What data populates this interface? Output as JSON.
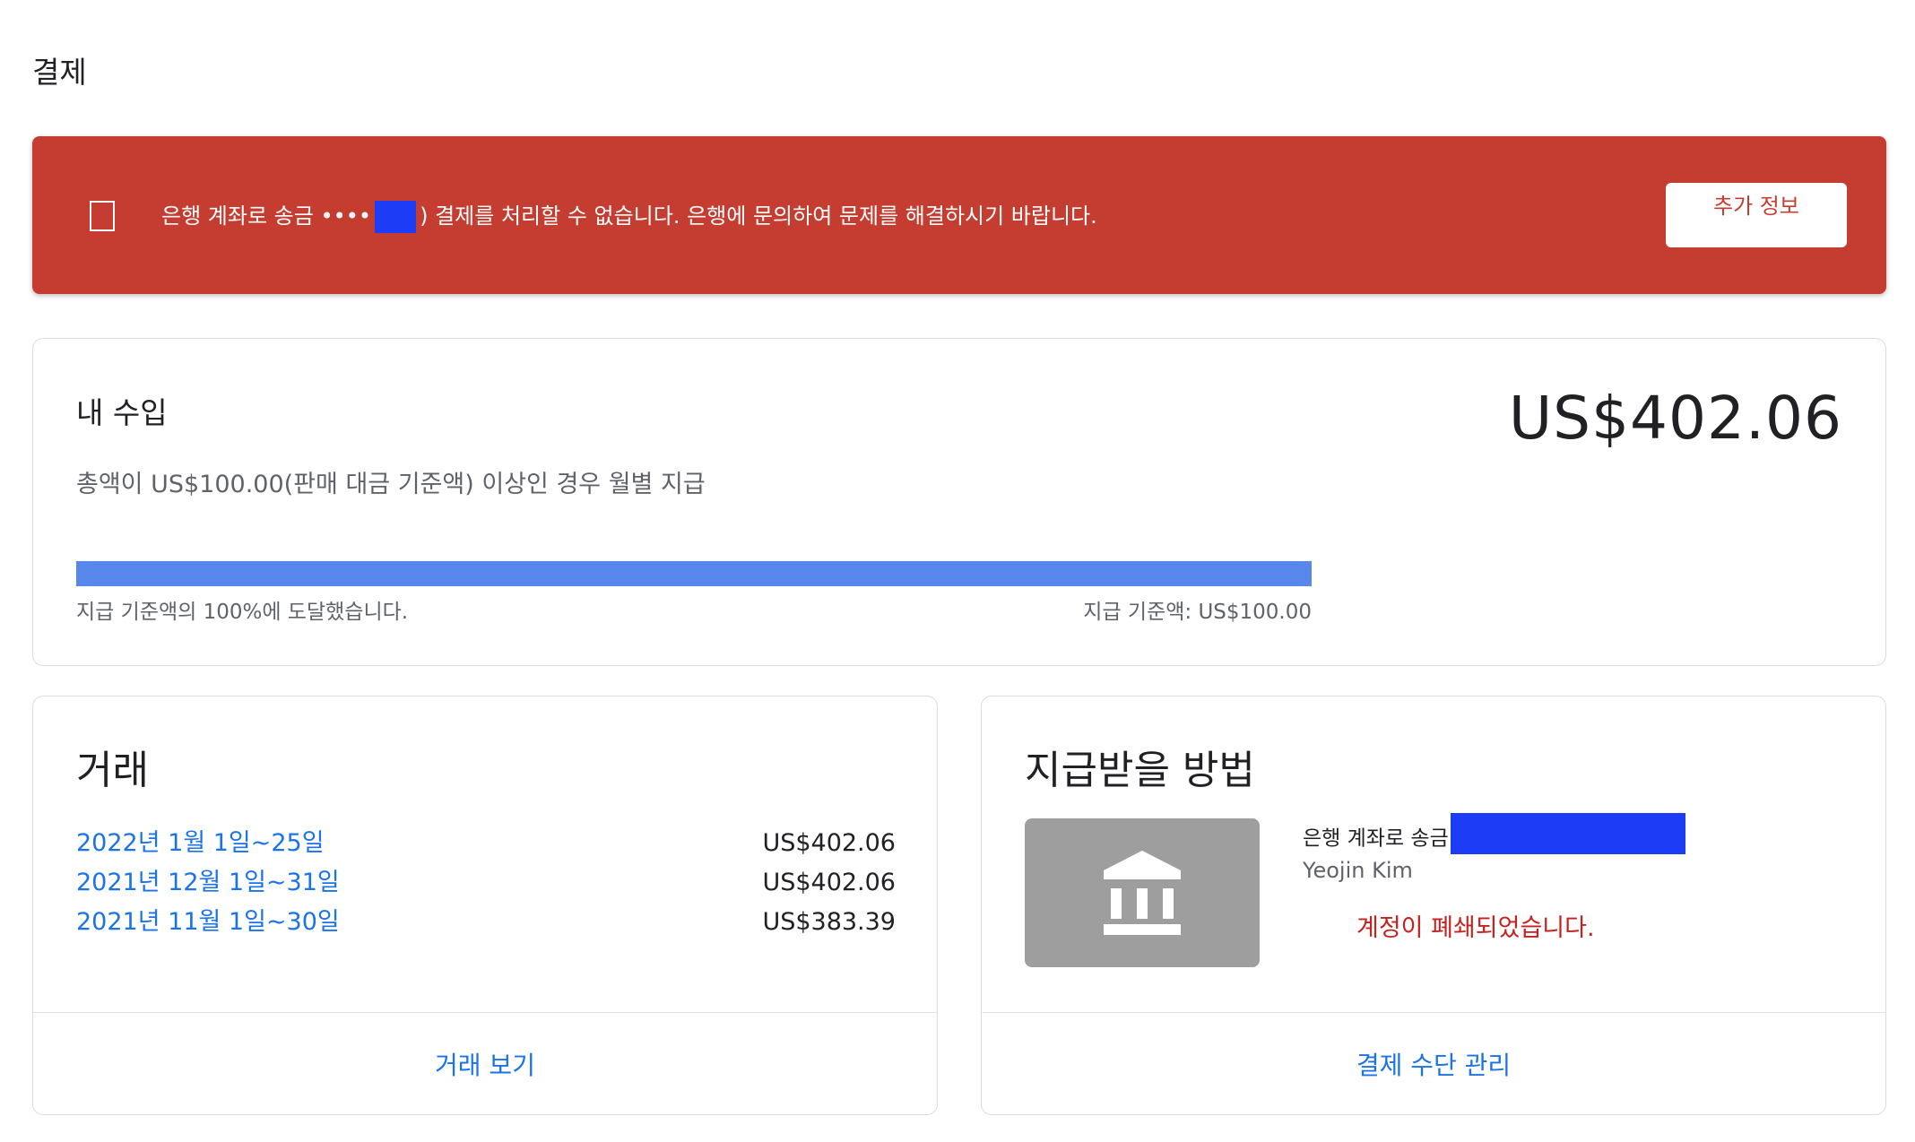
{
  "page": {
    "title": "결제"
  },
  "alert": {
    "text_prefix": "은행 계좌로 송금 ••••",
    "text_suffix": ") 결제를 처리할 수 없습니다. 은행에 문의하여 문제를 해결하시기 바랍니다.",
    "button_label": "추가 정보",
    "color": "#c53d31"
  },
  "earnings": {
    "title": "내 수입",
    "amount": "US$402.06",
    "subtitle": "총액이 US$100.00(판매 대금 기준액) 이상인 경우 월별 지급",
    "progress_fraction": 1.0,
    "progress_left_text": "지급 기준액의 100%에 도달했습니다.",
    "progress_right_text": "지급 기준액: US$100.00",
    "progress_color": "#5887ec"
  },
  "transactions": {
    "title": "거래",
    "rows": [
      {
        "date": "2022년 1월 1일~25일",
        "amount": "US$402.06"
      },
      {
        "date": "2021년 12월 1일~31일",
        "amount": "US$402.06"
      },
      {
        "date": "2021년 11월 1일~30일",
        "amount": "US$383.39"
      }
    ],
    "footer_link": "거래 보기"
  },
  "payment_method": {
    "title": "지급받을 방법",
    "icon": "bank-icon",
    "label": "은행 계좌로 송금",
    "holder": "Yeojin Kim",
    "status": "계정이 폐쇄되었습니다.",
    "footer_link": "결제 수단 관리"
  },
  "colors": {
    "link": "#1a73e8",
    "error": "#c5221f",
    "redaction": "#1c3cf6"
  }
}
